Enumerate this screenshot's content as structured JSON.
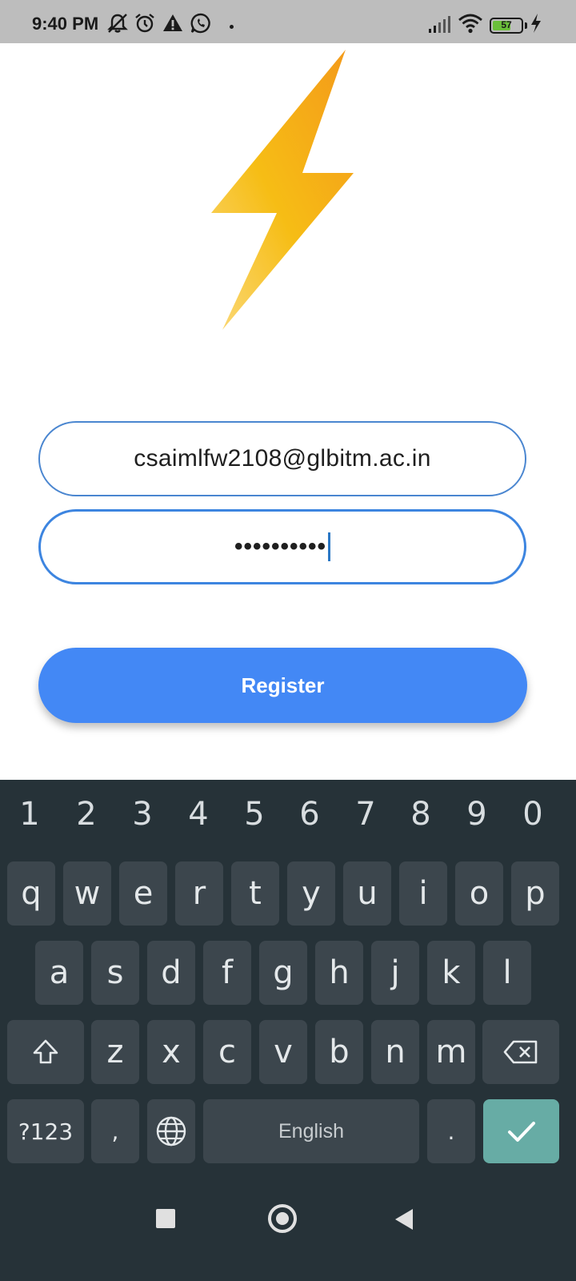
{
  "status_bar": {
    "time": "9:40 PM",
    "battery_level": "57",
    "icons": [
      "mute-bell-icon",
      "alarm-icon",
      "warning-icon",
      "whatsapp-icon",
      "signal-icon",
      "wifi-icon",
      "battery-icon",
      "charging-icon"
    ]
  },
  "logo": {
    "icon": "lightning-bolt-icon",
    "colors": [
      "#f7c21b",
      "#f4a018"
    ]
  },
  "form": {
    "email_value": "csaimlfw2108@glbitm.ac.in",
    "password_value": "••••••••••",
    "register_label": "Register"
  },
  "keyboard": {
    "numbers": [
      "1",
      "2",
      "3",
      "4",
      "5",
      "6",
      "7",
      "8",
      "9",
      "0"
    ],
    "row1": [
      "q",
      "w",
      "e",
      "r",
      "t",
      "y",
      "u",
      "i",
      "o",
      "p"
    ],
    "row2": [
      "a",
      "s",
      "d",
      "f",
      "g",
      "h",
      "j",
      "k",
      "l"
    ],
    "row3": [
      "z",
      "x",
      "c",
      "v",
      "b",
      "n",
      "m"
    ],
    "symbols_label": "?123",
    "comma_label": ",",
    "space_label": "English",
    "period_label": "."
  },
  "colors": {
    "accent": "#4388f5",
    "keyboard_bg": "#263238",
    "enter_key": "#67aca5"
  }
}
